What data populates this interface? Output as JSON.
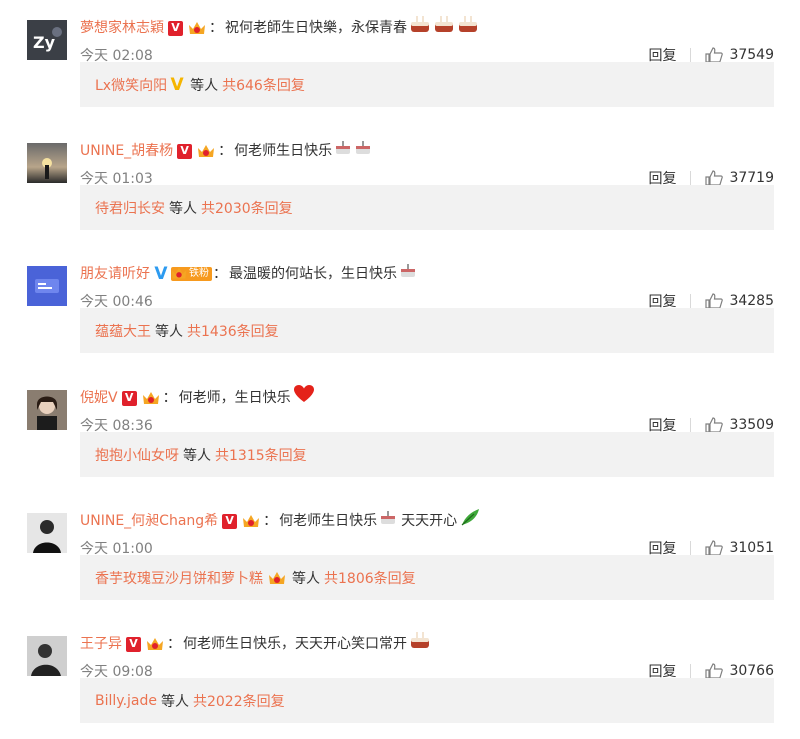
{
  "colors": {
    "accent": "#eb7350",
    "reply_bg": "#f2f2f2",
    "badge_red": "#e0212c",
    "badge_blue": "#2d9bf0",
    "badge_gold": "#f5b500"
  },
  "comments": [
    {
      "user": "夢想家林志穎",
      "sep": "：",
      "text": "祝何老師生日快樂，永保青春",
      "time": "今天 02:08",
      "reply_label": "回复",
      "likes": "37549",
      "reply_user": "Lx微笑向阳",
      "deng": "等人",
      "reply_count": "共646条回复"
    },
    {
      "user": "UNINE_胡春杨",
      "sep": "：",
      "text": "何老师生日快乐",
      "time": "今天 01:03",
      "reply_label": "回复",
      "likes": "37719",
      "reply_user": "待君归长安",
      "deng": "等人",
      "reply_count": "共2030条回复"
    },
    {
      "user": "朋友请听好",
      "sep": "：",
      "text": "最温暖的何站长，生日快乐",
      "fan_badge": "铁粉",
      "time": "今天 00:46",
      "reply_label": "回复",
      "likes": "34285",
      "reply_user": "蕴蕴大王",
      "deng": "等人",
      "reply_count": "共1436条回复"
    },
    {
      "user": "倪妮V",
      "sep": "：",
      "text": "何老师，生日快乐",
      "time": "今天 08:36",
      "reply_label": "回复",
      "likes": "33509",
      "reply_user": "抱抱小仙女呀",
      "deng": "等人",
      "reply_count": "共1315条回复"
    },
    {
      "user": "UNINE_何昶Chang希",
      "sep": "：",
      "text": "何老师生日快乐",
      "text2": "天天开心",
      "time": "今天 01:00",
      "reply_label": "回复",
      "likes": "31051",
      "reply_user": "香芋玫瑰豆沙月饼和萝卜糕",
      "deng": "等人",
      "reply_count": "共1806条回复"
    },
    {
      "user": "王子异",
      "sep": "：",
      "text": "何老师生日快乐，天天开心笑口常开",
      "time": "今天 09:08",
      "reply_label": "回复",
      "likes": "30766",
      "reply_user": "Billy.jade",
      "deng": "等人",
      "reply_count": "共2022条回复"
    }
  ]
}
